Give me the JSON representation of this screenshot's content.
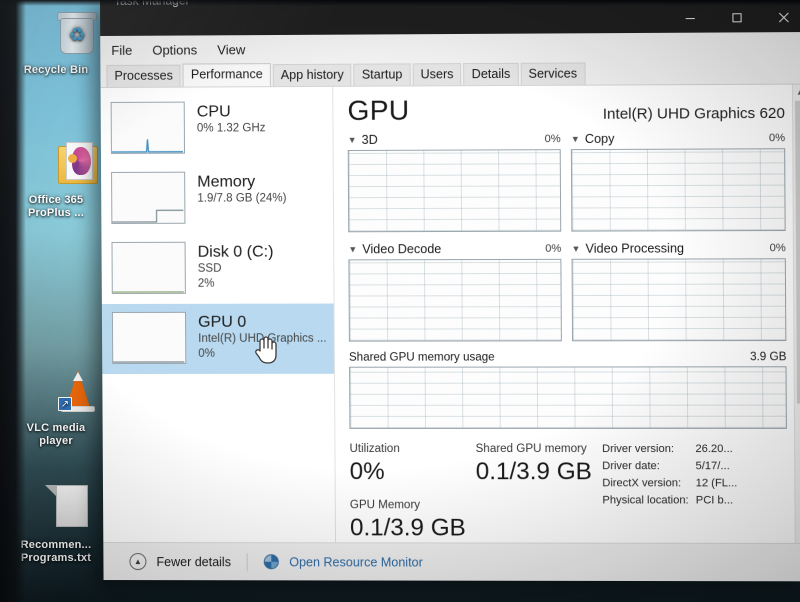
{
  "desktop": {
    "icons": [
      {
        "name": "recycle-bin",
        "label_line1": "Recycle Bin",
        "label_line2": ""
      },
      {
        "name": "office-365",
        "label_line1": "Office 365",
        "label_line2": "ProPlus ..."
      },
      {
        "name": "vlc-media-player",
        "label_line1": "VLC media",
        "label_line2": "player"
      },
      {
        "name": "recommended-programs-txt",
        "label_line1": "Recommen...",
        "label_line2": "Programs.txt"
      }
    ]
  },
  "window": {
    "title": "Task Manager",
    "controls": {
      "minimize": "minimize-icon",
      "maximize": "maximize-icon",
      "close": "close-icon"
    }
  },
  "menu": {
    "items": [
      "File",
      "Options",
      "View"
    ]
  },
  "tabs": [
    {
      "label": "Processes",
      "active": false
    },
    {
      "label": "Performance",
      "active": true
    },
    {
      "label": "App history",
      "active": false
    },
    {
      "label": "Startup",
      "active": false
    },
    {
      "label": "Users",
      "active": false
    },
    {
      "label": "Details",
      "active": false
    },
    {
      "label": "Services",
      "active": false
    }
  ],
  "sidebar": {
    "items": [
      {
        "title": "CPU",
        "sub1": "0%  1.32 GHz",
        "sub2": "",
        "selected": false
      },
      {
        "title": "Memory",
        "sub1": "1.9/7.8 GB (24%)",
        "sub2": "",
        "selected": false
      },
      {
        "title": "Disk 0 (C:)",
        "sub1": "SSD",
        "sub2": "2%",
        "selected": false
      },
      {
        "title": "GPU 0",
        "sub1": "Intel(R) UHD Graphics ...",
        "sub2": "0%",
        "selected": true
      }
    ]
  },
  "main": {
    "title": "GPU",
    "model": "Intel(R) UHD Graphics 620",
    "engines": [
      {
        "label": "3D",
        "percent": "0%"
      },
      {
        "label": "Copy",
        "percent": "0%"
      },
      {
        "label": "Video Decode",
        "percent": "0%"
      },
      {
        "label": "Video Processing",
        "percent": "0%"
      }
    ],
    "shared_graph": {
      "label": "Shared GPU memory usage",
      "max": "3.9 GB"
    },
    "stats": {
      "utilization_label": "Utilization",
      "utilization_value": "0%",
      "gpu_memory_label": "GPU Memory",
      "gpu_memory_value": "0.1/3.9 GB",
      "shared_memory_label": "Shared GPU memory",
      "shared_memory_value": "0.1/3.9 GB"
    },
    "details": [
      {
        "key": "Driver version:",
        "value": "26.20..."
      },
      {
        "key": "Driver date:",
        "value": "5/17/..."
      },
      {
        "key": "DirectX version:",
        "value": "12 (FL..."
      },
      {
        "key": "Physical location:",
        "value": "PCI b..."
      }
    ]
  },
  "footer": {
    "fewer_details": "Fewer details",
    "resource_monitor": "Open Resource Monitor"
  },
  "colors": {
    "selection": "#b8d9ef",
    "link": "#2c6ba8",
    "titlebar": "#1f1f1f",
    "chrome": "#f0f0f0"
  }
}
